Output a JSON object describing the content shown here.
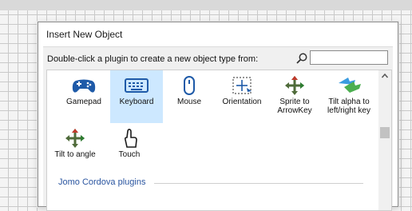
{
  "dialog": {
    "title": "Insert New Object",
    "hint": "Double-click a plugin to create a new object type from:",
    "search": {
      "value": "",
      "placeholder": ""
    }
  },
  "plugins": [
    {
      "label": "Gamepad",
      "icon": "gamepad-icon",
      "selected": false
    },
    {
      "label": "Keyboard",
      "icon": "keyboard-icon",
      "selected": true
    },
    {
      "label": "Mouse",
      "icon": "mouse-icon",
      "selected": false
    },
    {
      "label": "Orientation",
      "icon": "orientation-icon",
      "selected": false
    },
    {
      "label": "Sprite to ArrowKey",
      "icon": "sprite-to-arrowkey-icon",
      "selected": false
    },
    {
      "label": "Tilt alpha to left/right key",
      "icon": "tilt-alpha-icon",
      "selected": false
    },
    {
      "label": "Tilt to angle",
      "icon": "tilt-to-angle-icon",
      "selected": false
    },
    {
      "label": "Touch",
      "icon": "touch-icon",
      "selected": false
    }
  ],
  "section": {
    "label": "Jomo Cordova plugins"
  },
  "colors": {
    "selection": "#cde8ff",
    "section_text": "#2a55a0",
    "icon_blue": "#1e5aa8"
  }
}
